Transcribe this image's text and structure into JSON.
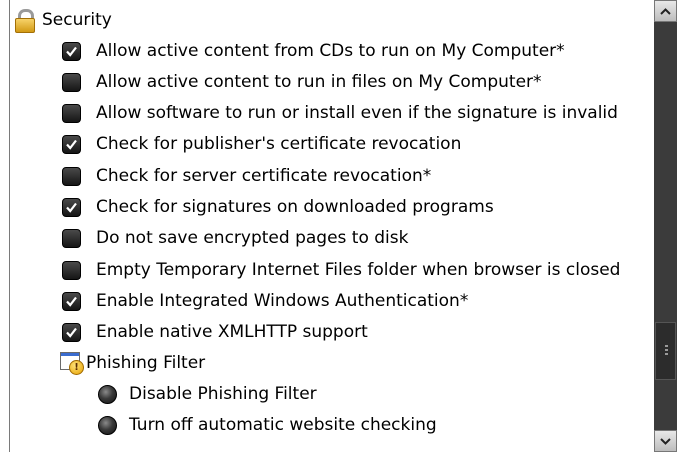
{
  "section": {
    "title": "Security",
    "icon": "padlock-icon"
  },
  "checkboxes": [
    {
      "label": "Allow active content from CDs to run on My Computer*",
      "checked": true
    },
    {
      "label": "Allow active content to run in files on My Computer*",
      "checked": false
    },
    {
      "label": "Allow software to run or install even if the signature is invalid",
      "checked": false
    },
    {
      "label": "Check for publisher's certificate revocation",
      "checked": true
    },
    {
      "label": "Check for server certificate revocation*",
      "checked": false
    },
    {
      "label": "Check for signatures on downloaded programs",
      "checked": true
    },
    {
      "label": "Do not save encrypted pages to disk",
      "checked": false
    },
    {
      "label": "Empty Temporary Internet Files folder when browser is closed",
      "checked": false
    },
    {
      "label": "Enable Integrated Windows Authentication*",
      "checked": true
    },
    {
      "label": "Enable native XMLHTTP support",
      "checked": true
    }
  ],
  "subsection": {
    "title": "Phishing Filter",
    "icon": "phishing-filter-icon"
  },
  "radios": [
    {
      "label": "Disable Phishing Filter"
    },
    {
      "label": "Turn off automatic website checking"
    }
  ],
  "colors": {
    "checkbox_fill": "#1e1e1e",
    "scrollbar_track": "#3b3b3b",
    "lock_gold": "#e0b030"
  }
}
